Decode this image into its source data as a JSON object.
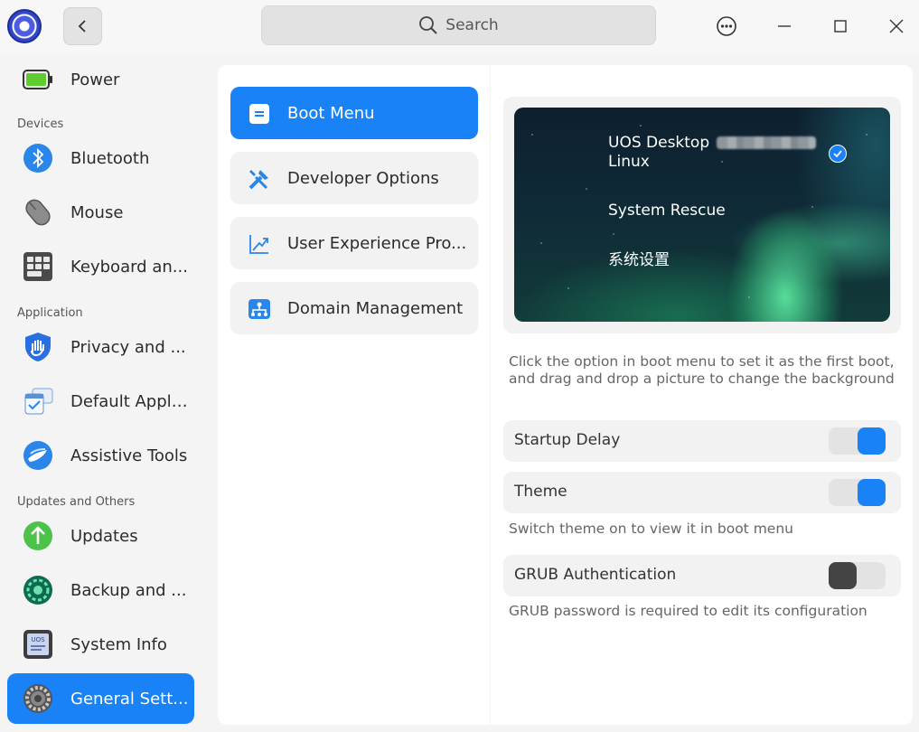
{
  "titlebar": {
    "search_placeholder": "Search",
    "icons": {
      "back": "chevron-left-icon",
      "search": "search-icon",
      "menu": "more-icon",
      "minimize": "minimize-icon",
      "maximize": "maximize-icon",
      "close": "close-icon"
    }
  },
  "sidebar": {
    "items": [
      {
        "label": "Power",
        "icon": "battery-icon"
      },
      {
        "group": "Devices"
      },
      {
        "label": "Bluetooth",
        "icon": "bluetooth-icon"
      },
      {
        "label": "Mouse",
        "icon": "mouse-icon"
      },
      {
        "label": "Keyboard and Language",
        "display": "Keyboard an...",
        "icon": "keyboard-icon"
      },
      {
        "group": "Application"
      },
      {
        "label": "Privacy and Security",
        "display": "Privacy and ...",
        "icon": "privacy-hand-icon"
      },
      {
        "label": "Default Applications",
        "display": "Default Appli...",
        "icon": "default-apps-icon"
      },
      {
        "label": "Assistive Tools",
        "icon": "assistive-icon"
      },
      {
        "group": "Updates and Others"
      },
      {
        "label": "Updates",
        "icon": "update-arrow-icon"
      },
      {
        "label": "Backup and Restore",
        "display": "Backup and ...",
        "icon": "backup-gear-icon"
      },
      {
        "label": "System Info",
        "icon": "system-info-icon"
      },
      {
        "label": "General Settings",
        "display": "General Sett...",
        "icon": "general-gear-icon",
        "active": true
      }
    ],
    "groups": {
      "devices": "Devices",
      "application": "Application",
      "updates": "Updates and Others"
    },
    "power": "Power",
    "bluetooth": "Bluetooth",
    "mouse": "Mouse",
    "keyboard": "Keyboard an...",
    "privacy": "Privacy and ...",
    "default_apps": "Default Appli...",
    "assistive": "Assistive Tools",
    "updates": "Updates",
    "backup": "Backup and ...",
    "sysinfo": "System Info",
    "general": "General Sett..."
  },
  "submenu": {
    "boot_menu": "Boot Menu",
    "developer": "Developer Options",
    "user_experience": "User Experience Pro...",
    "domain": "Domain Management"
  },
  "boot": {
    "entries": {
      "first_line": "UOS Desktop",
      "first_line2": "Linux",
      "second": "System Rescue",
      "third": "系统设置"
    },
    "hint": "Click the option in boot menu to set it as the first boot, and drag and drop a picture to change the background"
  },
  "settings": {
    "startup_delay": {
      "label": "Startup Delay",
      "on": true
    },
    "theme": {
      "label": "Theme",
      "on": true,
      "hint": "Switch theme on to view it in boot menu"
    },
    "grub_auth": {
      "label": "GRUB Authentication",
      "on": false,
      "hint": "GRUB password is required to edit its configuration"
    }
  },
  "colors": {
    "accent": "#1a82f7",
    "toggle_off": "#444444",
    "track": "#e3e3e3"
  }
}
